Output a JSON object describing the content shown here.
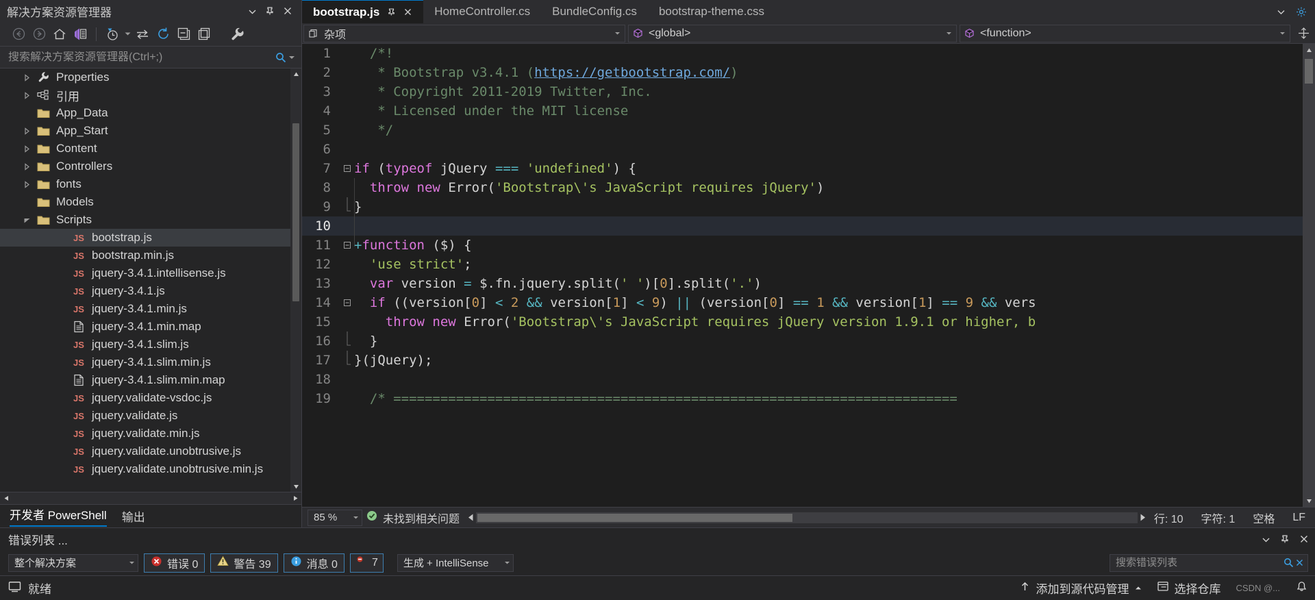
{
  "solution_explorer": {
    "title": "解决方案资源管理器",
    "header_buttons": [
      {
        "name": "chevron-down-icon",
        "label": "▾"
      },
      {
        "name": "pin-icon",
        "label": "Pin"
      },
      {
        "name": "close-icon",
        "label": "×"
      }
    ],
    "toolbar": [
      {
        "name": "back-icon",
        "label": "Back"
      },
      {
        "name": "forward-icon",
        "label": "Forward"
      },
      {
        "name": "home-icon",
        "label": "Home"
      },
      {
        "name": "vs-solution-icon",
        "label": "Solution"
      },
      {
        "name": "pending-changes-icon",
        "label": "Pending"
      },
      {
        "name": "sync-icon",
        "label": "Sync with Active Document"
      },
      {
        "name": "refresh-icon",
        "label": "Refresh"
      },
      {
        "name": "collapse-all-icon",
        "label": "Collapse All"
      },
      {
        "name": "properties-icon",
        "label": "Properties"
      },
      {
        "name": "wrench-icon",
        "label": "Settings"
      }
    ],
    "search_placeholder": "搜索解决方案资源管理器(Ctrl+;)",
    "tree": [
      {
        "label": "Properties",
        "icon": "wrench",
        "indent": 1,
        "twisty": "collapsed"
      },
      {
        "label": "引用",
        "icon": "references",
        "indent": 1,
        "twisty": "collapsed"
      },
      {
        "label": "App_Data",
        "icon": "folder",
        "indent": 1,
        "twisty": "none"
      },
      {
        "label": "App_Start",
        "icon": "folder",
        "indent": 1,
        "twisty": "collapsed"
      },
      {
        "label": "Content",
        "icon": "folder",
        "indent": 1,
        "twisty": "collapsed"
      },
      {
        "label": "Controllers",
        "icon": "folder",
        "indent": 1,
        "twisty": "collapsed"
      },
      {
        "label": "fonts",
        "icon": "folder",
        "indent": 1,
        "twisty": "collapsed"
      },
      {
        "label": "Models",
        "icon": "folder",
        "indent": 1,
        "twisty": "none"
      },
      {
        "label": "Scripts",
        "icon": "folder",
        "indent": 1,
        "twisty": "expanded"
      },
      {
        "label": "bootstrap.js",
        "icon": "js",
        "indent": 2,
        "twisty": "none",
        "selected": true
      },
      {
        "label": "bootstrap.min.js",
        "icon": "js",
        "indent": 2,
        "twisty": "none"
      },
      {
        "label": "jquery-3.4.1.intellisense.js",
        "icon": "js",
        "indent": 2,
        "twisty": "none"
      },
      {
        "label": "jquery-3.4.1.js",
        "icon": "js",
        "indent": 2,
        "twisty": "none"
      },
      {
        "label": "jquery-3.4.1.min.js",
        "icon": "js",
        "indent": 2,
        "twisty": "none"
      },
      {
        "label": "jquery-3.4.1.min.map",
        "icon": "file",
        "indent": 2,
        "twisty": "none"
      },
      {
        "label": "jquery-3.4.1.slim.js",
        "icon": "js",
        "indent": 2,
        "twisty": "none"
      },
      {
        "label": "jquery-3.4.1.slim.min.js",
        "icon": "js",
        "indent": 2,
        "twisty": "none"
      },
      {
        "label": "jquery-3.4.1.slim.min.map",
        "icon": "file",
        "indent": 2,
        "twisty": "none"
      },
      {
        "label": "jquery.validate-vsdoc.js",
        "icon": "js",
        "indent": 2,
        "twisty": "none"
      },
      {
        "label": "jquery.validate.js",
        "icon": "js",
        "indent": 2,
        "twisty": "none"
      },
      {
        "label": "jquery.validate.min.js",
        "icon": "js",
        "indent": 2,
        "twisty": "none"
      },
      {
        "label": "jquery.validate.unobtrusive.js",
        "icon": "js",
        "indent": 2,
        "twisty": "none"
      },
      {
        "label": "jquery.validate.unobtrusive.min.js",
        "icon": "js",
        "indent": 2,
        "twisty": "none"
      }
    ],
    "bottom_tabs": [
      {
        "label": "开发者 PowerShell",
        "active": true
      },
      {
        "label": "输出",
        "active": false
      }
    ]
  },
  "editor": {
    "tabs": [
      {
        "label": "bootstrap.js",
        "active": true,
        "pinned": true,
        "closable": true
      },
      {
        "label": "HomeController.cs",
        "active": false
      },
      {
        "label": "BundleConfig.cs",
        "active": false
      },
      {
        "label": "bootstrap-theme.css",
        "active": false
      }
    ],
    "tabstrip_buttons": [
      {
        "name": "tab-overflow-icon",
        "label": "▾"
      },
      {
        "name": "settings-gear-icon",
        "label": "Settings"
      }
    ],
    "navbar": {
      "project": "杂项",
      "scope": "<global>",
      "member": "<function>",
      "split_label": "Split"
    },
    "lines": [
      {
        "num": "1",
        "fold": "none",
        "current": false,
        "tokens": [
          {
            "t": "  ",
            "c": "pln"
          },
          {
            "t": "/*!",
            "c": "cmt"
          }
        ]
      },
      {
        "num": "2",
        "fold": "none",
        "current": false,
        "tokens": [
          {
            "t": "   * Bootstrap v3.4.1 (",
            "c": "cmt"
          },
          {
            "t": "https://getbootstrap.com/",
            "c": "lnk"
          },
          {
            "t": ")",
            "c": "cmt"
          }
        ]
      },
      {
        "num": "3",
        "fold": "none",
        "current": false,
        "tokens": [
          {
            "t": "   * Copyright 2011-2019 Twitter, Inc.",
            "c": "cmt"
          }
        ]
      },
      {
        "num": "4",
        "fold": "none",
        "current": false,
        "tokens": [
          {
            "t": "   * Licensed under the MIT license",
            "c": "cmt"
          }
        ]
      },
      {
        "num": "5",
        "fold": "none",
        "current": false,
        "tokens": [
          {
            "t": "   */",
            "c": "cmt"
          }
        ]
      },
      {
        "num": "6",
        "fold": "none",
        "current": false,
        "tokens": []
      },
      {
        "num": "7",
        "fold": "collapse",
        "current": false,
        "tokens": [
          {
            "t": "if",
            "c": "kw"
          },
          {
            "t": " (",
            "c": "pln"
          },
          {
            "t": "typeof",
            "c": "kw"
          },
          {
            "t": " jQuery ",
            "c": "pln"
          },
          {
            "t": "===",
            "c": "op"
          },
          {
            "t": " ",
            "c": "pln"
          },
          {
            "t": "'undefined'",
            "c": "str"
          },
          {
            "t": ") {",
            "c": "pln"
          }
        ]
      },
      {
        "num": "8",
        "fold": "none",
        "current": false,
        "tokens": [
          {
            "t": "  ",
            "c": "pln"
          },
          {
            "t": "throw",
            "c": "kw"
          },
          {
            "t": " ",
            "c": "pln"
          },
          {
            "t": "new",
            "c": "kw"
          },
          {
            "t": " Error(",
            "c": "pln"
          },
          {
            "t": "'Bootstrap\\'s JavaScript requires jQuery'",
            "c": "str"
          },
          {
            "t": ")",
            "c": "pln"
          }
        ]
      },
      {
        "num": "9",
        "fold": "end",
        "current": false,
        "tokens": [
          {
            "t": "}",
            "c": "pln"
          }
        ]
      },
      {
        "num": "10",
        "fold": "none",
        "current": true,
        "tokens": []
      },
      {
        "num": "11",
        "fold": "collapse",
        "current": false,
        "tokens": [
          {
            "t": "+",
            "c": "op"
          },
          {
            "t": "function",
            "c": "kw"
          },
          {
            "t": " ($) {",
            "c": "pln"
          }
        ]
      },
      {
        "num": "12",
        "fold": "none",
        "current": false,
        "tokens": [
          {
            "t": "  ",
            "c": "pln"
          },
          {
            "t": "'use strict'",
            "c": "str"
          },
          {
            "t": ";",
            "c": "pln"
          }
        ]
      },
      {
        "num": "13",
        "fold": "none",
        "current": false,
        "tokens": [
          {
            "t": "  ",
            "c": "pln"
          },
          {
            "t": "var",
            "c": "kw"
          },
          {
            "t": " version ",
            "c": "pln"
          },
          {
            "t": "=",
            "c": "op"
          },
          {
            "t": " $.fn.jquery.split(",
            "c": "pln"
          },
          {
            "t": "' '",
            "c": "str"
          },
          {
            "t": ")[",
            "c": "pln"
          },
          {
            "t": "0",
            "c": "num"
          },
          {
            "t": "].split(",
            "c": "pln"
          },
          {
            "t": "'.'",
            "c": "str"
          },
          {
            "t": ")",
            "c": "pln"
          }
        ]
      },
      {
        "num": "14",
        "fold": "collapse",
        "current": false,
        "tokens": [
          {
            "t": "  ",
            "c": "pln"
          },
          {
            "t": "if",
            "c": "kw"
          },
          {
            "t": " ((version[",
            "c": "pln"
          },
          {
            "t": "0",
            "c": "num"
          },
          {
            "t": "] ",
            "c": "pln"
          },
          {
            "t": "<",
            "c": "op"
          },
          {
            "t": " ",
            "c": "pln"
          },
          {
            "t": "2",
            "c": "num"
          },
          {
            "t": " ",
            "c": "pln"
          },
          {
            "t": "&&",
            "c": "op"
          },
          {
            "t": " version[",
            "c": "pln"
          },
          {
            "t": "1",
            "c": "num"
          },
          {
            "t": "] ",
            "c": "pln"
          },
          {
            "t": "<",
            "c": "op"
          },
          {
            "t": " ",
            "c": "pln"
          },
          {
            "t": "9",
            "c": "num"
          },
          {
            "t": ") ",
            "c": "pln"
          },
          {
            "t": "||",
            "c": "op"
          },
          {
            "t": " (version[",
            "c": "pln"
          },
          {
            "t": "0",
            "c": "num"
          },
          {
            "t": "] ",
            "c": "pln"
          },
          {
            "t": "==",
            "c": "op"
          },
          {
            "t": " ",
            "c": "pln"
          },
          {
            "t": "1",
            "c": "num"
          },
          {
            "t": " ",
            "c": "pln"
          },
          {
            "t": "&&",
            "c": "op"
          },
          {
            "t": " version[",
            "c": "pln"
          },
          {
            "t": "1",
            "c": "num"
          },
          {
            "t": "] ",
            "c": "pln"
          },
          {
            "t": "==",
            "c": "op"
          },
          {
            "t": " ",
            "c": "pln"
          },
          {
            "t": "9",
            "c": "num"
          },
          {
            "t": " ",
            "c": "pln"
          },
          {
            "t": "&&",
            "c": "op"
          },
          {
            "t": " vers",
            "c": "pln"
          }
        ]
      },
      {
        "num": "15",
        "fold": "none",
        "current": false,
        "tokens": [
          {
            "t": "    ",
            "c": "pln"
          },
          {
            "t": "throw",
            "c": "kw"
          },
          {
            "t": " ",
            "c": "pln"
          },
          {
            "t": "new",
            "c": "kw"
          },
          {
            "t": " Error(",
            "c": "pln"
          },
          {
            "t": "'Bootstrap\\'s JavaScript requires jQuery version 1.9.1 or higher, b",
            "c": "str"
          }
        ]
      },
      {
        "num": "16",
        "fold": "end",
        "current": false,
        "tokens": [
          {
            "t": "  }",
            "c": "pln"
          }
        ]
      },
      {
        "num": "17",
        "fold": "endmain",
        "current": false,
        "tokens": [
          {
            "t": "}(jQuery);",
            "c": "pln"
          }
        ]
      },
      {
        "num": "18",
        "fold": "none",
        "current": false,
        "tokens": []
      },
      {
        "num": "19",
        "fold": "none",
        "current": false,
        "tokens": [
          {
            "t": "  /* ========================================================================",
            "c": "cmt"
          }
        ]
      }
    ],
    "status": {
      "zoom": "85 %",
      "message": "未找到相关问题",
      "line_label": "行: 10",
      "col_label": "字符: 1",
      "space_label": "空格",
      "eol_label": "LF"
    }
  },
  "error_list": {
    "title": "错误列表 ...",
    "header_buttons": [
      {
        "name": "chevron-down-icon",
        "label": "▾"
      },
      {
        "name": "pin-icon",
        "label": "Pin"
      },
      {
        "name": "close-icon",
        "label": "×"
      }
    ],
    "scope_select": "整个解决方案",
    "chips": [
      {
        "name": "errors-chip",
        "icon": "error",
        "label": "错误 0"
      },
      {
        "name": "warnings-chip",
        "icon": "warning",
        "label": "警告 39"
      },
      {
        "name": "messages-chip",
        "icon": "info",
        "label": "消息 0"
      },
      {
        "name": "suppressed-chip",
        "icon": "suppressed",
        "label": "7"
      }
    ],
    "build_select": "生成 + IntelliSense",
    "search_placeholder": "搜索错误列表"
  },
  "status_bar": {
    "ready_label": "就绪",
    "source_control_label": "添加到源代码管理",
    "repo_label": "选择仓库",
    "watermark": "CSDN @...",
    "icons": [
      {
        "name": "status-ready-icon"
      },
      {
        "name": "upload-arrow-icon"
      },
      {
        "name": "repository-icon"
      },
      {
        "name": "notifications-icon"
      }
    ]
  },
  "colors": {
    "accent": "#007acc",
    "panel_bg": "#252526",
    "editor_bg": "#1e1e1e",
    "toolbar_bg": "#2d2d30",
    "error_red": "#c9302c",
    "warning_yellow": "#d7b740",
    "info_blue": "#3b9ee0",
    "ok_green": "#76c76f"
  }
}
